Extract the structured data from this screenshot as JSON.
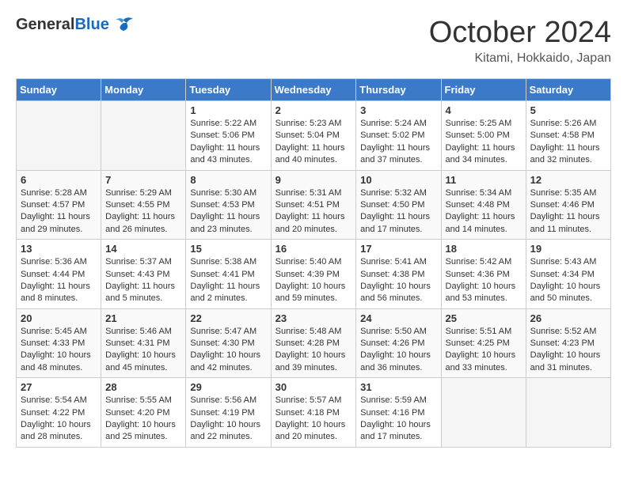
{
  "header": {
    "logo_general": "General",
    "logo_blue": "Blue",
    "month_title": "October 2024",
    "location": "Kitami, Hokkaido, Japan"
  },
  "days_of_week": [
    "Sunday",
    "Monday",
    "Tuesday",
    "Wednesday",
    "Thursday",
    "Friday",
    "Saturday"
  ],
  "weeks": [
    [
      {
        "day": "",
        "sunrise": "",
        "sunset": "",
        "daylight": "",
        "empty": true
      },
      {
        "day": "",
        "sunrise": "",
        "sunset": "",
        "daylight": "",
        "empty": true
      },
      {
        "day": "1",
        "sunrise": "Sunrise: 5:22 AM",
        "sunset": "Sunset: 5:06 PM",
        "daylight": "Daylight: 11 hours and 43 minutes.",
        "empty": false
      },
      {
        "day": "2",
        "sunrise": "Sunrise: 5:23 AM",
        "sunset": "Sunset: 5:04 PM",
        "daylight": "Daylight: 11 hours and 40 minutes.",
        "empty": false
      },
      {
        "day": "3",
        "sunrise": "Sunrise: 5:24 AM",
        "sunset": "Sunset: 5:02 PM",
        "daylight": "Daylight: 11 hours and 37 minutes.",
        "empty": false
      },
      {
        "day": "4",
        "sunrise": "Sunrise: 5:25 AM",
        "sunset": "Sunset: 5:00 PM",
        "daylight": "Daylight: 11 hours and 34 minutes.",
        "empty": false
      },
      {
        "day": "5",
        "sunrise": "Sunrise: 5:26 AM",
        "sunset": "Sunset: 4:58 PM",
        "daylight": "Daylight: 11 hours and 32 minutes.",
        "empty": false
      }
    ],
    [
      {
        "day": "6",
        "sunrise": "Sunrise: 5:28 AM",
        "sunset": "Sunset: 4:57 PM",
        "daylight": "Daylight: 11 hours and 29 minutes.",
        "empty": false
      },
      {
        "day": "7",
        "sunrise": "Sunrise: 5:29 AM",
        "sunset": "Sunset: 4:55 PM",
        "daylight": "Daylight: 11 hours and 26 minutes.",
        "empty": false
      },
      {
        "day": "8",
        "sunrise": "Sunrise: 5:30 AM",
        "sunset": "Sunset: 4:53 PM",
        "daylight": "Daylight: 11 hours and 23 minutes.",
        "empty": false
      },
      {
        "day": "9",
        "sunrise": "Sunrise: 5:31 AM",
        "sunset": "Sunset: 4:51 PM",
        "daylight": "Daylight: 11 hours and 20 minutes.",
        "empty": false
      },
      {
        "day": "10",
        "sunrise": "Sunrise: 5:32 AM",
        "sunset": "Sunset: 4:50 PM",
        "daylight": "Daylight: 11 hours and 17 minutes.",
        "empty": false
      },
      {
        "day": "11",
        "sunrise": "Sunrise: 5:34 AM",
        "sunset": "Sunset: 4:48 PM",
        "daylight": "Daylight: 11 hours and 14 minutes.",
        "empty": false
      },
      {
        "day": "12",
        "sunrise": "Sunrise: 5:35 AM",
        "sunset": "Sunset: 4:46 PM",
        "daylight": "Daylight: 11 hours and 11 minutes.",
        "empty": false
      }
    ],
    [
      {
        "day": "13",
        "sunrise": "Sunrise: 5:36 AM",
        "sunset": "Sunset: 4:44 PM",
        "daylight": "Daylight: 11 hours and 8 minutes.",
        "empty": false
      },
      {
        "day": "14",
        "sunrise": "Sunrise: 5:37 AM",
        "sunset": "Sunset: 4:43 PM",
        "daylight": "Daylight: 11 hours and 5 minutes.",
        "empty": false
      },
      {
        "day": "15",
        "sunrise": "Sunrise: 5:38 AM",
        "sunset": "Sunset: 4:41 PM",
        "daylight": "Daylight: 11 hours and 2 minutes.",
        "empty": false
      },
      {
        "day": "16",
        "sunrise": "Sunrise: 5:40 AM",
        "sunset": "Sunset: 4:39 PM",
        "daylight": "Daylight: 10 hours and 59 minutes.",
        "empty": false
      },
      {
        "day": "17",
        "sunrise": "Sunrise: 5:41 AM",
        "sunset": "Sunset: 4:38 PM",
        "daylight": "Daylight: 10 hours and 56 minutes.",
        "empty": false
      },
      {
        "day": "18",
        "sunrise": "Sunrise: 5:42 AM",
        "sunset": "Sunset: 4:36 PM",
        "daylight": "Daylight: 10 hours and 53 minutes.",
        "empty": false
      },
      {
        "day": "19",
        "sunrise": "Sunrise: 5:43 AM",
        "sunset": "Sunset: 4:34 PM",
        "daylight": "Daylight: 10 hours and 50 minutes.",
        "empty": false
      }
    ],
    [
      {
        "day": "20",
        "sunrise": "Sunrise: 5:45 AM",
        "sunset": "Sunset: 4:33 PM",
        "daylight": "Daylight: 10 hours and 48 minutes.",
        "empty": false
      },
      {
        "day": "21",
        "sunrise": "Sunrise: 5:46 AM",
        "sunset": "Sunset: 4:31 PM",
        "daylight": "Daylight: 10 hours and 45 minutes.",
        "empty": false
      },
      {
        "day": "22",
        "sunrise": "Sunrise: 5:47 AM",
        "sunset": "Sunset: 4:30 PM",
        "daylight": "Daylight: 10 hours and 42 minutes.",
        "empty": false
      },
      {
        "day": "23",
        "sunrise": "Sunrise: 5:48 AM",
        "sunset": "Sunset: 4:28 PM",
        "daylight": "Daylight: 10 hours and 39 minutes.",
        "empty": false
      },
      {
        "day": "24",
        "sunrise": "Sunrise: 5:50 AM",
        "sunset": "Sunset: 4:26 PM",
        "daylight": "Daylight: 10 hours and 36 minutes.",
        "empty": false
      },
      {
        "day": "25",
        "sunrise": "Sunrise: 5:51 AM",
        "sunset": "Sunset: 4:25 PM",
        "daylight": "Daylight: 10 hours and 33 minutes.",
        "empty": false
      },
      {
        "day": "26",
        "sunrise": "Sunrise: 5:52 AM",
        "sunset": "Sunset: 4:23 PM",
        "daylight": "Daylight: 10 hours and 31 minutes.",
        "empty": false
      }
    ],
    [
      {
        "day": "27",
        "sunrise": "Sunrise: 5:54 AM",
        "sunset": "Sunset: 4:22 PM",
        "daylight": "Daylight: 10 hours and 28 minutes.",
        "empty": false
      },
      {
        "day": "28",
        "sunrise": "Sunrise: 5:55 AM",
        "sunset": "Sunset: 4:20 PM",
        "daylight": "Daylight: 10 hours and 25 minutes.",
        "empty": false
      },
      {
        "day": "29",
        "sunrise": "Sunrise: 5:56 AM",
        "sunset": "Sunset: 4:19 PM",
        "daylight": "Daylight: 10 hours and 22 minutes.",
        "empty": false
      },
      {
        "day": "30",
        "sunrise": "Sunrise: 5:57 AM",
        "sunset": "Sunset: 4:18 PM",
        "daylight": "Daylight: 10 hours and 20 minutes.",
        "empty": false
      },
      {
        "day": "31",
        "sunrise": "Sunrise: 5:59 AM",
        "sunset": "Sunset: 4:16 PM",
        "daylight": "Daylight: 10 hours and 17 minutes.",
        "empty": false
      },
      {
        "day": "",
        "sunrise": "",
        "sunset": "",
        "daylight": "",
        "empty": true
      },
      {
        "day": "",
        "sunrise": "",
        "sunset": "",
        "daylight": "",
        "empty": true
      }
    ]
  ]
}
